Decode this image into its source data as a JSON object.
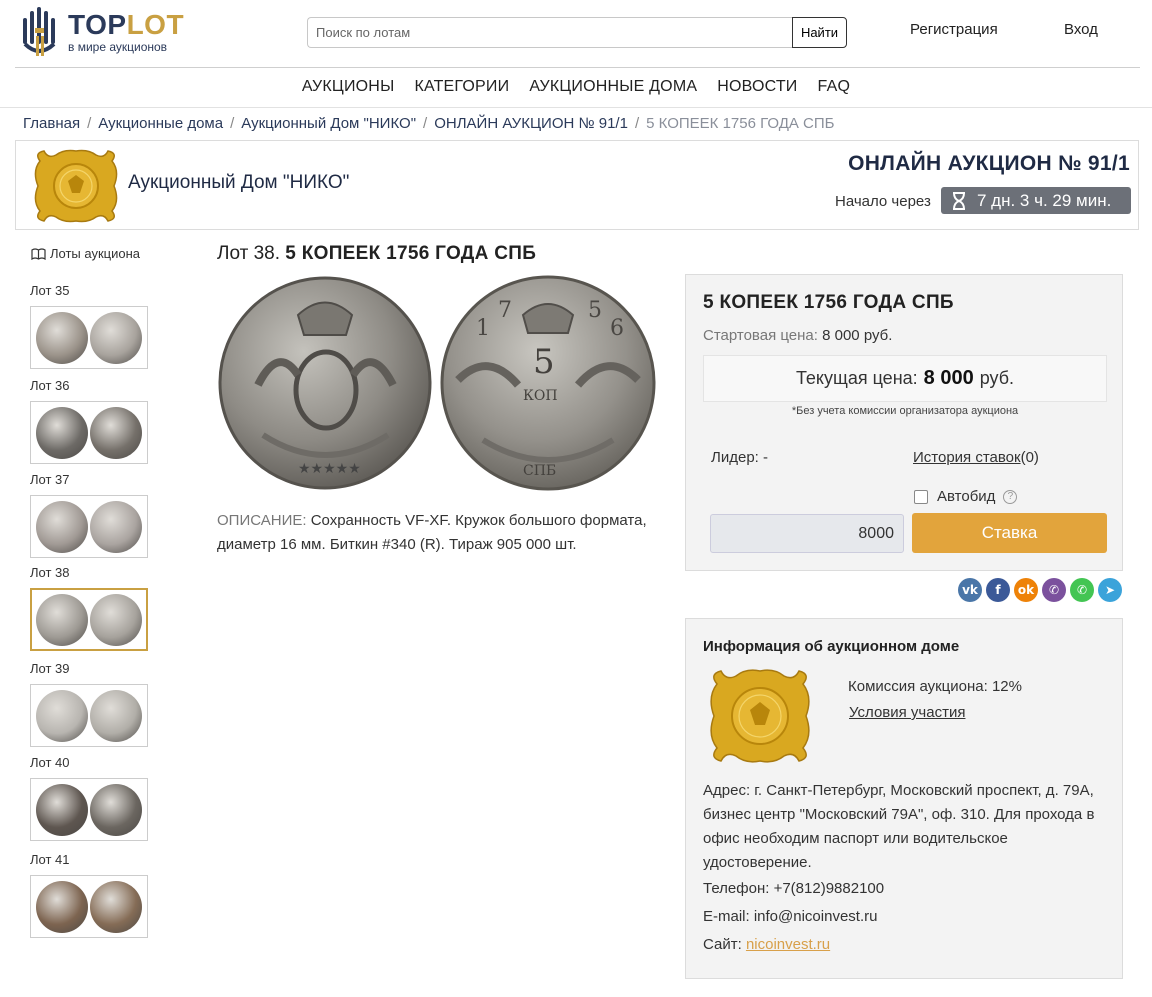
{
  "header": {
    "logo_title_a": "TOP",
    "logo_title_b": "LOT",
    "logo_subtitle": "в мире аукционов",
    "search_placeholder": "Поиск по лотам",
    "search_button": "Найти",
    "register": "Регистрация",
    "login": "Вход"
  },
  "nav": [
    "АУКЦИОНЫ",
    "КАТЕГОРИИ",
    "АУКЦИОННЫЕ ДОМА",
    "НОВОСТИ",
    "FAQ"
  ],
  "breadcrumb": [
    "Главная",
    "Аукционные дома",
    "Аукционный Дом \"НИКО\"",
    "ОНЛАЙН АУКЦИОН № 91/1",
    "5 КОПЕЕК 1756 ГОДА СПБ"
  ],
  "auction": {
    "house_name": "Аукционный Дом \"НИКО\"",
    "title": "ОНЛАЙН АУКЦИОН № 91/1",
    "starts_label": "Начало через",
    "timer": "7 дн. 3 ч. 29 мин."
  },
  "sidebar": {
    "heading": "Лоты аукциона",
    "lots": [
      {
        "label": "Лот 35",
        "active": false,
        "c1": "#9b938a",
        "c2": "#a8a39d"
      },
      {
        "label": "Лот 36",
        "active": false,
        "c1": "#6d6a66",
        "c2": "#75706a"
      },
      {
        "label": "Лот 37",
        "active": false,
        "c1": "#a19a95",
        "c2": "#aaa4a0"
      },
      {
        "label": "Лот 38",
        "active": true,
        "c1": "#9e9a94",
        "c2": "#a6a29c"
      },
      {
        "label": "Лот 39",
        "active": false,
        "c1": "#b8b5b0",
        "c2": "#b1aea8"
      },
      {
        "label": "Лот 40",
        "active": false,
        "c1": "#5e5650",
        "c2": "#6b6660"
      },
      {
        "label": "Лот 41",
        "active": false,
        "c1": "#7d6450",
        "c2": "#856c56"
      }
    ]
  },
  "lot": {
    "prefix": "Лот 38.",
    "title": "5 КОПЕЕК 1756 ГОДА СПБ",
    "description_label": "ОПИСАНИЕ:",
    "description": "Сохранность VF-XF. Кружок большого формата, диаметр 16 мм. Биткин #340 (R). Тираж 905 000 шт."
  },
  "bid": {
    "title": "5 КОПЕЕК 1756 ГОДА СПБ",
    "start_label": "Стартовая цена:",
    "start_value": "8 000 руб.",
    "current_label": "Текущая цена:",
    "current_value": "8 000",
    "current_unit": "руб.",
    "note": "*Без учета комиссии организатора аукциона",
    "leader_label": "Лидер:",
    "leader_value": "-",
    "history_link": "История ставок",
    "history_count": "(0)",
    "autobid": "Автобид",
    "input_value": "8000",
    "button": "Ставка"
  },
  "share": [
    {
      "name": "vk",
      "glyph": "vk",
      "color": "#4a76a8"
    },
    {
      "name": "facebook",
      "glyph": "f",
      "color": "#3b5998"
    },
    {
      "name": "odnoklassniki",
      "glyph": "ok",
      "color": "#ee8208"
    },
    {
      "name": "viber",
      "glyph": "✆",
      "color": "#7b519d"
    },
    {
      "name": "whatsapp",
      "glyph": "✆",
      "color": "#43c553"
    },
    {
      "name": "telegram",
      "glyph": "➤",
      "color": "#3ba3da"
    }
  ],
  "house_info": {
    "title": "Информация об аукционном доме",
    "commission_label": "Комиссия аукциона:",
    "commission_value": "12%",
    "terms": "Условия участия",
    "address": "Адрес: г. Санкт-Петербург, Московский проспект, д. 79А, бизнес центр \"Московский 79А\", оф. 310. Для прохода в офис необходим паспорт или водительское удостоверение.",
    "phone_label": "Телефон:",
    "phone": "+7(812)9882100",
    "email_label": "E-mail:",
    "email": "info@nicoinvest.ru",
    "site_label": "Сайт:",
    "site": "nicoinvest.ru"
  },
  "colors": {
    "accent": "#c9a042",
    "brand": "#2b3a5a",
    "bid_button": "#e2a43c",
    "timer_bg": "#6c7078"
  }
}
